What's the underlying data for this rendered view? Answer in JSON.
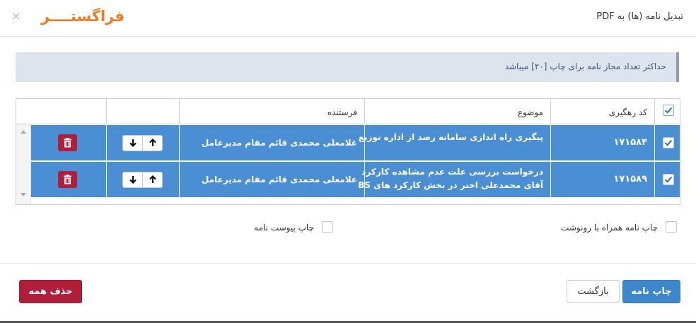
{
  "header": {
    "title": "تبدیل نامه (ها) به PDF",
    "close_label": "×",
    "logo_text": "فراگستــــر"
  },
  "alert": {
    "text": "حداکثر تعداد مجاز نامه برای چاپ [۲۰] میباشد"
  },
  "table": {
    "columns": {
      "tracking_code": "کد رهگیری",
      "subject": "موضوع",
      "sender": "فرستنده"
    },
    "rows": [
      {
        "tracking_code": "۱۷۱۵۸۴",
        "subject_line1": "پیگیری راه اندازی سامانه رصد از اداره توزیع",
        "subject_line2": "",
        "sender": "غلامعلی محمدی قائم مقام مدیرعامل",
        "checked": true
      },
      {
        "tracking_code": "۱۷۱۵۸۹",
        "subject_line1": "درخواست بررسی علت عدم مشاهده کارکرد",
        "subject_line2": "آقای محمدعلی اختر در بخش کارکرد های BS",
        "sender": "غلامعلی محمدی قائم مقام مدیرعامل",
        "checked": true
      }
    ]
  },
  "options": {
    "print_with_copy": "چاپ نامه همراه با رونوشت",
    "print_attachments": "چاپ پیوست نامه"
  },
  "footer": {
    "print_label": "چاپ نامه",
    "back_label": "بازگشت",
    "delete_all_label": "حذف همه"
  },
  "colors": {
    "accent": "#3d87cc",
    "row_selected": "#4a8fd4",
    "danger": "#b01e3a",
    "logo": "#f47a20"
  }
}
